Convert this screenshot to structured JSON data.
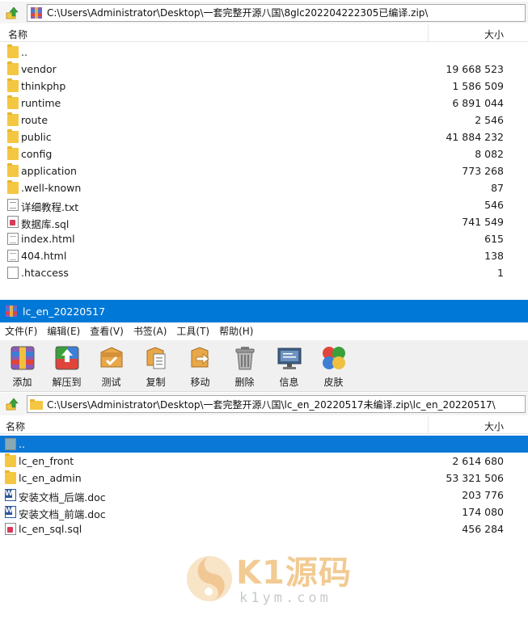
{
  "top_pane": {
    "path": "C:\\Users\\Administrator\\Desktop\\一套完整开源八国\\8glc202204222305已编译.zip\\",
    "columns": {
      "name": "名称",
      "size": "大小"
    },
    "items": [
      {
        "name": "..",
        "size": "",
        "type": "folder"
      },
      {
        "name": "vendor",
        "size": "19 668 523",
        "type": "folder"
      },
      {
        "name": "thinkphp",
        "size": "1 586 509",
        "type": "folder"
      },
      {
        "name": "runtime",
        "size": "6 891 044",
        "type": "folder"
      },
      {
        "name": "route",
        "size": "2 546",
        "type": "folder"
      },
      {
        "name": "public",
        "size": "41 884 232",
        "type": "folder"
      },
      {
        "name": "config",
        "size": "8 082",
        "type": "folder"
      },
      {
        "name": "application",
        "size": "773 268",
        "type": "folder"
      },
      {
        "name": ".well-known",
        "size": "87",
        "type": "folder"
      },
      {
        "name": "详细教程.txt",
        "size": "546",
        "type": "txt"
      },
      {
        "name": "数据库.sql",
        "size": "741 549",
        "type": "sql"
      },
      {
        "name": "index.html",
        "size": "615",
        "type": "html"
      },
      {
        "name": "404.html",
        "size": "138",
        "type": "html"
      },
      {
        "name": ".htaccess",
        "size": "1",
        "type": "plain"
      }
    ]
  },
  "window": {
    "title": "lc_en_20220517",
    "menu": [
      "文件(F)",
      "编辑(E)",
      "查看(V)",
      "书签(A)",
      "工具(T)",
      "帮助(H)"
    ],
    "toolbar": [
      {
        "label": "添加",
        "icon": "add-archive-icon"
      },
      {
        "label": "解压到",
        "icon": "extract-icon"
      },
      {
        "label": "测试",
        "icon": "test-icon"
      },
      {
        "label": "复制",
        "icon": "copy-icon"
      },
      {
        "label": "移动",
        "icon": "move-icon"
      },
      {
        "label": "删除",
        "icon": "trash-icon"
      },
      {
        "label": "信息",
        "icon": "info-monitor-icon"
      },
      {
        "label": "皮肤",
        "icon": "skin-palette-icon"
      }
    ],
    "path": "C:\\Users\\Administrator\\Desktop\\一套完整开源八国\\lc_en_20220517未编译.zip\\lc_en_20220517\\",
    "columns": {
      "name": "名称",
      "size": "大小"
    },
    "items": [
      {
        "name": "..",
        "size": "",
        "type": "up",
        "selected": true
      },
      {
        "name": "lc_en_front",
        "size": "2 614 680",
        "type": "folder"
      },
      {
        "name": "lc_en_admin",
        "size": "53 321 506",
        "type": "folder"
      },
      {
        "name": "安装文档_后端.doc",
        "size": "203 776",
        "type": "word"
      },
      {
        "name": "安装文档_前端.doc",
        "size": "174 080",
        "type": "word"
      },
      {
        "name": "lc_en_sql.sql",
        "size": "456 284",
        "type": "sql"
      }
    ]
  },
  "watermark": {
    "brand": "K1源码",
    "url": "k1ym.com"
  },
  "colors": {
    "accent": "#0078d7",
    "selection": "#0a78d7",
    "folder": "#f4c742"
  }
}
